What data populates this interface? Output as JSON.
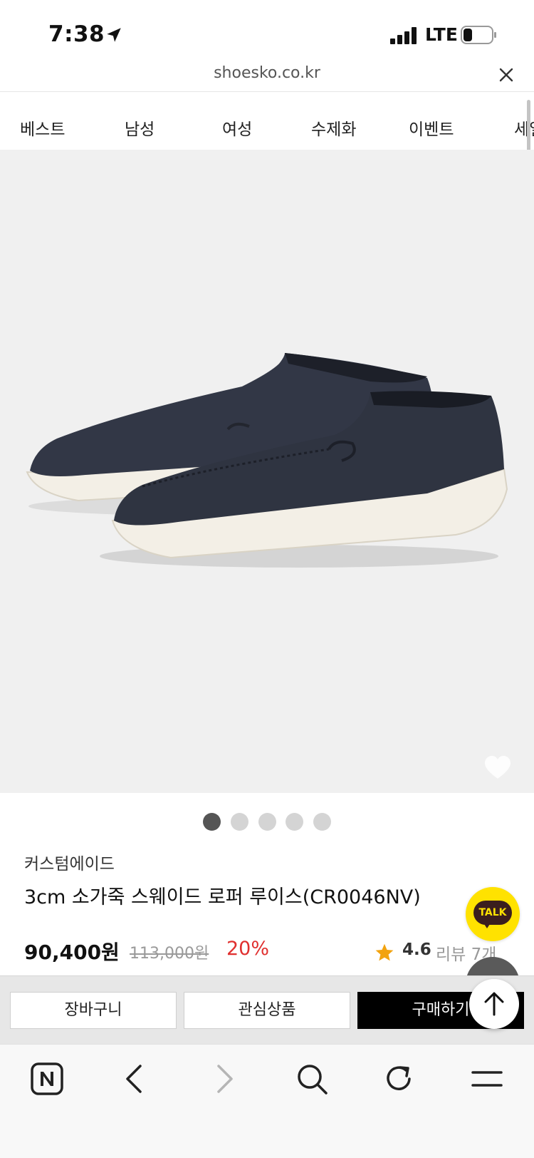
{
  "status": {
    "time": "7:38",
    "network": "LTE"
  },
  "browser": {
    "url": "shoesko.co.kr"
  },
  "nav": {
    "items": [
      "베스트",
      "남성",
      "여성",
      "수제화",
      "이벤트",
      "세일"
    ]
  },
  "gallery": {
    "total": 5,
    "active_index": 0
  },
  "product": {
    "brand": "커스텀에이드",
    "title": "3cm 소가죽 스웨이드 로퍼 루이스(CR0046NV)",
    "price": "90,400원",
    "original_price": "113,000원",
    "discount": "20%",
    "rating": "4.6",
    "review": "리뷰 7개"
  },
  "chat": {
    "label": "TALK"
  },
  "actions": {
    "cart": "장바구니",
    "wishlist": "관심상품",
    "buy": "구매하기"
  },
  "colors": {
    "discount": "#e0302f",
    "talk_bg": "#ffe200",
    "star": "#f2a30f",
    "shoe": "#2f3441",
    "sole": "#f3efe6"
  },
  "icons": [
    "location-arrow-icon",
    "signal-icon",
    "battery-icon",
    "close-icon",
    "heart-icon",
    "star-icon",
    "arrow-up-icon",
    "naver-icon",
    "back-icon",
    "forward-icon",
    "search-icon",
    "refresh-icon",
    "menu-icon"
  ]
}
